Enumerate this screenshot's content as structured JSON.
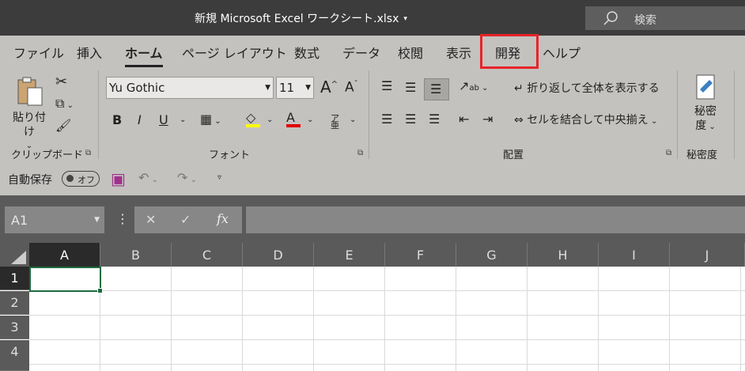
{
  "titlebar": {
    "title": "新規 Microsoft Excel ワークシート.xlsx",
    "title_caret": "▾",
    "search_placeholder": "検索",
    "search_icon": "search-icon"
  },
  "tabs": [
    "ファイル",
    "挿入",
    "ホーム",
    "ページ レイアウト",
    "数式",
    "データ",
    "校閲",
    "表示",
    "開発",
    "ヘルプ"
  ],
  "active_tab": "ホーム",
  "highlighted_tab": "開発",
  "highlight_color": "#e8232a",
  "clipboard": {
    "paste_label": "貼り付け",
    "group_label": "クリップボード"
  },
  "font": {
    "name": "Yu Gothic",
    "size": "11",
    "group_label": "フォント",
    "bold": "B",
    "italic": "I",
    "underline": "U",
    "font_color_label": "A",
    "highlight_color": "#ffff00",
    "font_color": "#e00000",
    "furigana": "ア亜"
  },
  "alignment": {
    "wrap_label": "折り返して全体を表示する",
    "merge_label": "セルを結合して中央揃え",
    "group_label": "配置"
  },
  "sensitivity": {
    "button_line1": "秘密",
    "button_line2": "度",
    "group_label": "秘密度"
  },
  "qat": {
    "autosave_label": "自動保存",
    "autosave_state": "オフ",
    "save_color": "#a0308c"
  },
  "formula_bar": {
    "name_box": "A1",
    "cancel": "✕",
    "enter": "✓",
    "fx": "fx",
    "more": "⋮"
  },
  "grid": {
    "columns": [
      "A",
      "B",
      "C",
      "D",
      "E",
      "F",
      "G",
      "H",
      "I",
      "J"
    ],
    "rows": [
      "1",
      "2",
      "3",
      "4"
    ],
    "selected_cell": "A1",
    "selection_color": "#1e6b41"
  }
}
